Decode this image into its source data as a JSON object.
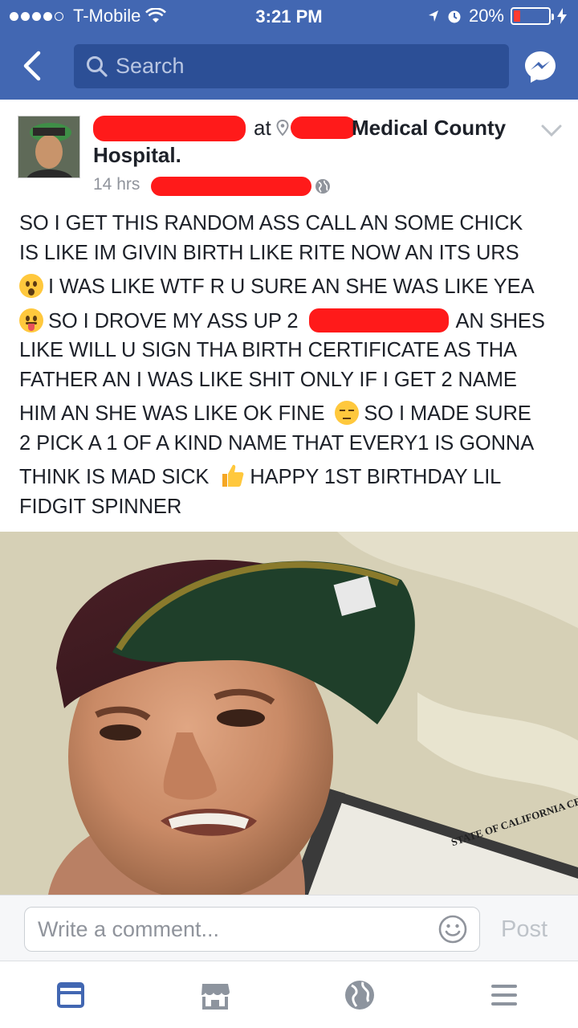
{
  "status_bar": {
    "carrier": "T-Mobile",
    "time": "3:21 PM",
    "battery": "20%",
    "battery_level": 0.2,
    "signal_bars": 4,
    "icons": [
      "wifi-icon",
      "location-arrow-icon",
      "alarm-clock-icon",
      "charging-bolt-icon"
    ]
  },
  "nav": {
    "search_placeholder": "Search",
    "icons": [
      "back-chevron-icon",
      "search-icon",
      "messenger-icon"
    ]
  },
  "post": {
    "at_text": "at",
    "place_line1": "Medical County",
    "place_line2": "Hospital.",
    "time": "14 hrs",
    "text_lines": [
      "SO I GET THIS RANDOM ASS CALL AN SOME CHICK",
      "IS LIKE IM GIVIN BIRTH LIKE RITE NOW AN ITS URS",
      "I WAS LIKE WTF R U SURE AN SHE WAS LIKE YEA",
      "SO I DROVE MY ASS UP 2",
      "AN SHES",
      "LIKE WILL U SIGN THA BIRTH CERTIFICATE AS THA",
      "FATHER AN I WAS LIKE SHIT ONLY IF I GET 2 NAME",
      "HIM AN SHE WAS LIKE OK FINE",
      "SO I MADE SURE",
      "2 PICK A 1 OF A KIND NAME THAT EVERY1 IS GONNA",
      "THINK IS MAD SICK",
      "HAPPY 1ST BIRTHDAY LIL",
      "FIDGIT SPINNER"
    ],
    "emojis": [
      "astonished-face-icon",
      "tongue-face-icon",
      "unamused-face-icon",
      "thumbs-up-icon"
    ],
    "photo_text": "STATE OF CALIFORNIA CERTIFICATION OF VITAL"
  },
  "comment": {
    "placeholder": "Write a comment...",
    "post_label": "Post"
  },
  "tabs": [
    {
      "icon": "news-feed-icon",
      "active": true
    },
    {
      "icon": "marketplace-icon",
      "active": false
    },
    {
      "icon": "notifications-globe-icon",
      "active": false
    },
    {
      "icon": "menu-icon",
      "active": false
    }
  ],
  "colors": {
    "header_blue": "#4267b2",
    "search_bg": "#2c4f96",
    "redaction_red": "#ff1a1a",
    "active_tab": "#4267b2",
    "inactive_tab": "#8d949e"
  }
}
